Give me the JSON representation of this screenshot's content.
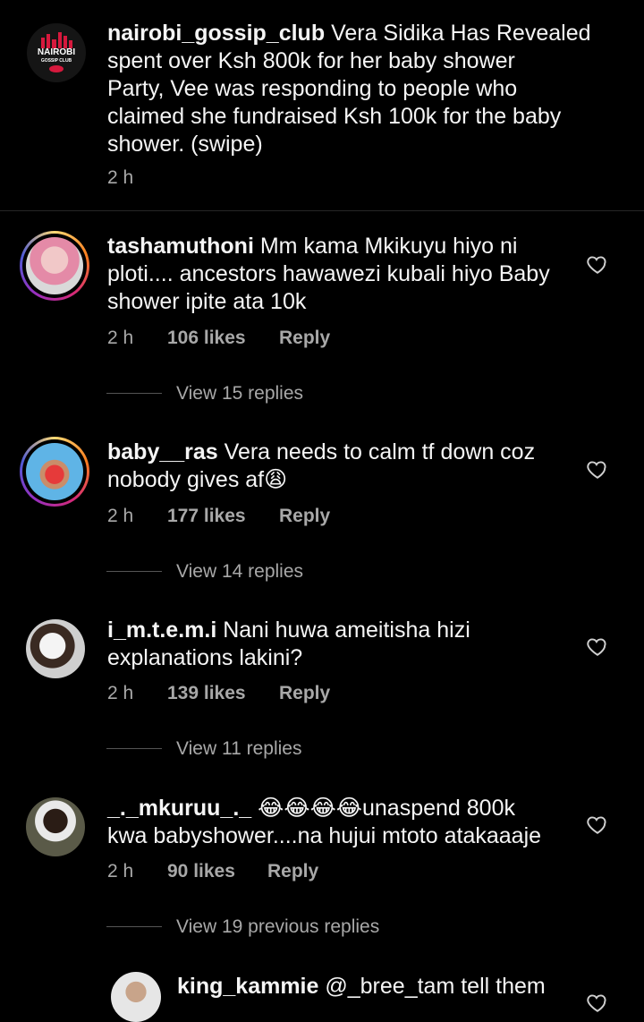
{
  "post": {
    "username": "nairobi_gossip_club",
    "caption_line1": "Vera Sidika Has Revealed",
    "caption_line2": "spent over Ksh 800k for her baby shower",
    "caption_line3": "Party, Vee was responding to people who",
    "caption_line4": "claimed she fundraised Ksh 100k for the baby",
    "caption_line5": "shower. (swipe)",
    "time": "2 h",
    "logo_line1": "NAIROBI",
    "logo_line2": "GOSSIP CLUB"
  },
  "comments": [
    {
      "username": "tashamuthoni",
      "line1": "Mm kama Mkikuyu hiyo ni",
      "line2": "ploti.... ancestors hawawezi kubali hiyo Baby",
      "line3": "shower ipite ata 10k",
      "time": "2 h",
      "likes": "106 likes",
      "reply": "Reply",
      "view_replies": "View 15 replies"
    },
    {
      "username": "baby__ras",
      "line1": "Vera needs to calm tf down coz",
      "line2": "nobody gives af😩",
      "time": "2 h",
      "likes": "177 likes",
      "reply": "Reply",
      "view_replies": "View 14 replies"
    },
    {
      "username": "i_m.t.e.m.i",
      "line1": "Nani huwa ameitisha hizi",
      "line2": "explanations lakini?",
      "time": "2 h",
      "likes": "139 likes",
      "reply": "Reply",
      "view_replies": "View 11 replies"
    },
    {
      "username": "_._mkuruu_._",
      "line1": "😂😂😂😂unaspend 800k",
      "line2": "kwa babyshower....na hujui mtoto atakaaaje",
      "time": "2 h",
      "likes": "90 likes",
      "reply": "Reply",
      "view_replies": "View 19 previous replies"
    }
  ],
  "nested_reply": {
    "username": "king_kammie",
    "text": "@_bree_tam tell them"
  },
  "colors": {
    "background": "#000000",
    "text": "#f5f5f5",
    "secondary": "#a8a8a8",
    "divider": "#262626"
  }
}
